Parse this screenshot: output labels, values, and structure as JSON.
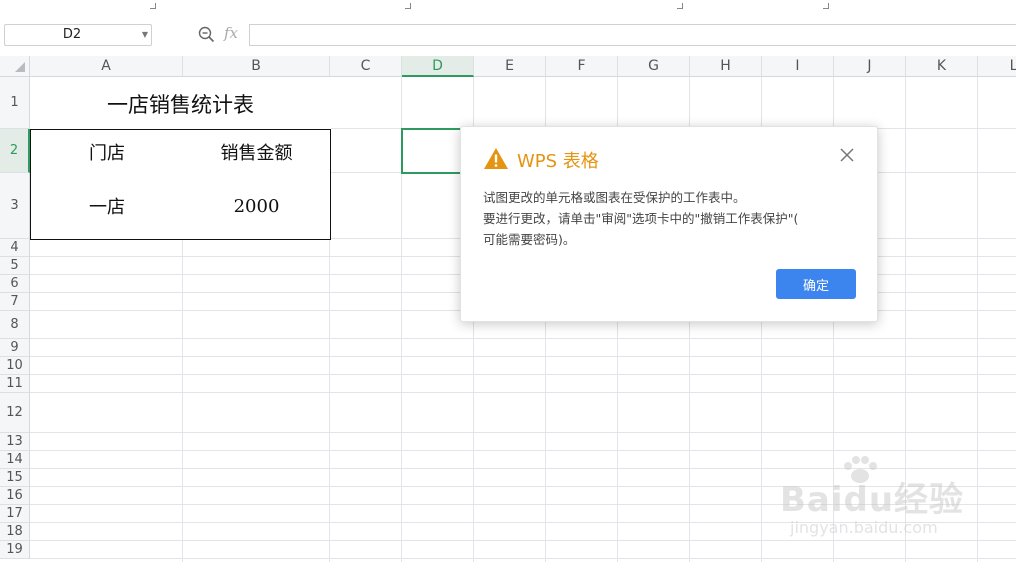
{
  "name_box": {
    "value": "D2"
  },
  "formula_bar": {
    "fx_label": "fx",
    "value": ""
  },
  "columns": [
    "A",
    "B",
    "C",
    "D",
    "E",
    "F",
    "G",
    "H",
    "I",
    "J",
    "K",
    "L"
  ],
  "selected_column": "D",
  "rows": [
    "1",
    "2",
    "3",
    "4",
    "5",
    "6",
    "7",
    "8",
    "9",
    "10",
    "11",
    "12",
    "13",
    "14",
    "15",
    "16",
    "17",
    "18",
    "19"
  ],
  "selected_row": "2",
  "sheet": {
    "title": "一店销售统计表",
    "header_store": "门店",
    "header_sales": "销售金额",
    "row_store": "一店",
    "row_sales": "2000"
  },
  "dialog": {
    "title": "WPS 表格",
    "message_line1": "试图更改的单元格或图表在受保护的工作表中。",
    "message_line2": "要进行更改，请单击\"审阅\"选项卡中的\"撤销工作表保护\"(",
    "message_line3": "可能需要密码)。",
    "ok_label": "确定",
    "warning_color": "#e59412",
    "button_color": "#3d85ee"
  },
  "watermark": {
    "brand": "Baidu经验",
    "url": "jingyan.baidu.com"
  },
  "colors": {
    "selection": "#2f9a5f",
    "gridline": "#e1e4e8"
  }
}
